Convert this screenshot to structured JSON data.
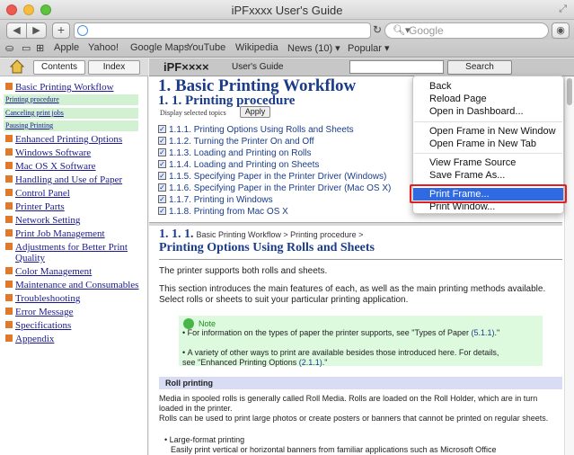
{
  "window": {
    "title": "iPFxxxx User's Guide"
  },
  "toolbar": {
    "url": "",
    "search_placeholder": "Google"
  },
  "bookmarks": [
    "Apple",
    "Yahoo!",
    "Google Maps",
    "YouTube",
    "Wikipedia",
    "News (10) ▾",
    "Popular ▾"
  ],
  "sidebar": {
    "tab_contents": "Contents",
    "tab_index": "Index",
    "items": [
      "Basic Printing Workflow",
      "Enhanced Printing Options",
      "Windows Software",
      "Mac OS X Software",
      "Handling and Use of Paper",
      "Control Panel",
      "Printer Parts",
      "Network Setting",
      "Print Job Management",
      "Adjustments for Better Print",
      "Quality",
      "Color Management",
      "Maintenance and Consumables",
      "Troubleshooting",
      "Error Message",
      "Specifications",
      "Appendix"
    ],
    "subitems": [
      "Printing procedure",
      "Canceling print jobs",
      "Pausing Printing"
    ]
  },
  "header": {
    "brand": "iPF××××",
    "guide_label": "User's Guide",
    "search_button": "Search"
  },
  "main": {
    "title": "1. Basic Printing Workflow",
    "subtitle": "1. 1. Printing procedure",
    "display_label": "Display selected topics",
    "apply_button": "Apply",
    "topics": [
      "1.1.1. Printing Options Using Rolls and Sheets",
      "1.1.2. Turning the Printer On and Off",
      "1.1.3. Loading and Printing on Rolls",
      "1.1.4. Loading and Printing on Sheets",
      "1.1.5. Specifying Paper in the Printer Driver (Windows)",
      "1.1.6. Specifying Paper in the Printer Driver (Mac OS X)",
      "1.1.7. Printing in Windows",
      "1.1.8. Printing from Mac OS X"
    ],
    "section_number": "1. 1. 1.",
    "section_crumb": "Basic Printing Workflow > Printing procedure >",
    "section_heading": "Printing Options Using Rolls and Sheets",
    "para1": "The printer supports both rolls and sheets.",
    "para2": "This section introduces the main features of each, as well as the main printing methods available. Select rolls or sheets to suit your particular printing application.",
    "note_label": "Note",
    "note1a": "For information on the types of paper the printer supports, see \"Types of Paper ",
    "note1_link": "(5.1.1)",
    "note1b": ".\"",
    "note2a": "A variety of other ways to print are available besides those introduced here. For details, see \"Enhanced Printing Options ",
    "note2_link": "(2.1.1)",
    "note2b": ".\"",
    "roll_heading": "Roll printing",
    "roll_p1": "Media in spooled rolls is generally called Roll Media. Rolls are loaded on the Roll Holder, which are in turn loaded in the printer.",
    "roll_p2": "Rolls can be used to print large photos or create posters or banners that cannot be printed on regular sheets.",
    "roll_b1": "• Large-format printing",
    "roll_b1_desc": "Easily print vertical or horizontal banners from familiar applications such as Microsoft Office"
  },
  "context_menu": {
    "items": [
      "Back",
      "Reload Page",
      "Open in Dashboard...",
      "Open Frame in New Window",
      "Open Frame in New Tab",
      "View Frame Source",
      "Save Frame As...",
      "Print Frame...",
      "Print Window..."
    ],
    "highlighted": "Print Frame...",
    "highlight_color": "#2f6ae3",
    "annotation_color": "#e02020"
  }
}
